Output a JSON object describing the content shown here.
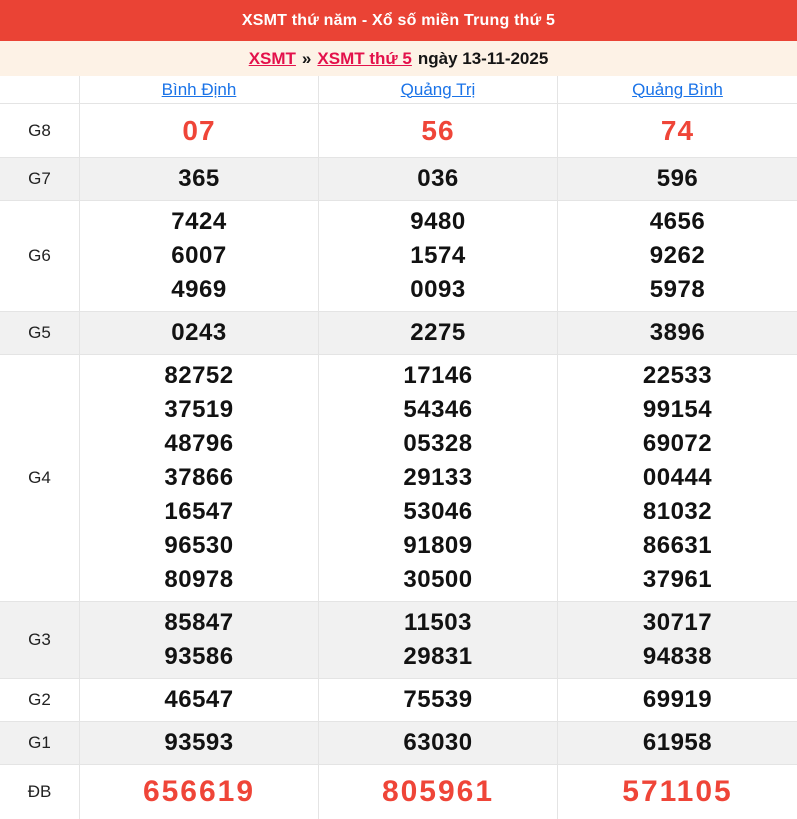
{
  "header": {
    "title": "XSMT thứ năm - Xổ số miền Trung thứ 5"
  },
  "breadcrumb": {
    "link_xsmt": "XSMT",
    "separator": "»",
    "link_day": "XSMT thứ 5",
    "date_text": "ngày 13-11-2025"
  },
  "table": {
    "columns": [
      "Bình Định",
      "Quảng Trị",
      "Quảng Bình"
    ],
    "rows": [
      {
        "label": "G8",
        "highlight": true,
        "values": [
          [
            "07"
          ],
          [
            "56"
          ],
          [
            "74"
          ]
        ]
      },
      {
        "label": "G7",
        "highlight": false,
        "values": [
          [
            "365"
          ],
          [
            "036"
          ],
          [
            "596"
          ]
        ]
      },
      {
        "label": "G6",
        "highlight": false,
        "values": [
          [
            "7424",
            "6007",
            "4969"
          ],
          [
            "9480",
            "1574",
            "0093"
          ],
          [
            "4656",
            "9262",
            "5978"
          ]
        ]
      },
      {
        "label": "G5",
        "highlight": false,
        "values": [
          [
            "0243"
          ],
          [
            "2275"
          ],
          [
            "3896"
          ]
        ]
      },
      {
        "label": "G4",
        "highlight": false,
        "values": [
          [
            "82752",
            "37519",
            "48796",
            "37866",
            "16547",
            "96530",
            "80978"
          ],
          [
            "17146",
            "54346",
            "05328",
            "29133",
            "53046",
            "91809",
            "30500"
          ],
          [
            "22533",
            "99154",
            "69072",
            "00444",
            "81032",
            "86631",
            "37961"
          ]
        ]
      },
      {
        "label": "G3",
        "highlight": false,
        "values": [
          [
            "85847",
            "93586"
          ],
          [
            "11503",
            "29831"
          ],
          [
            "30717",
            "94838"
          ]
        ]
      },
      {
        "label": "G2",
        "highlight": false,
        "values": [
          [
            "46547"
          ],
          [
            "75539"
          ],
          [
            "69919"
          ]
        ]
      },
      {
        "label": "G1",
        "highlight": false,
        "values": [
          [
            "93593"
          ],
          [
            "63030"
          ],
          [
            "61958"
          ]
        ]
      },
      {
        "label": "ĐB",
        "highlight": true,
        "values": [
          [
            "656619"
          ],
          [
            "805961"
          ],
          [
            "571105"
          ]
        ]
      }
    ]
  },
  "colors": {
    "header_bg": "#EA4335",
    "breadcrumb_bg": "#FDF2E6",
    "link_red": "#E3114B",
    "link_blue": "#1A73E8",
    "number_red": "#EF4538",
    "stripe": "#F1F1F1",
    "border": "#E4E4E4"
  }
}
